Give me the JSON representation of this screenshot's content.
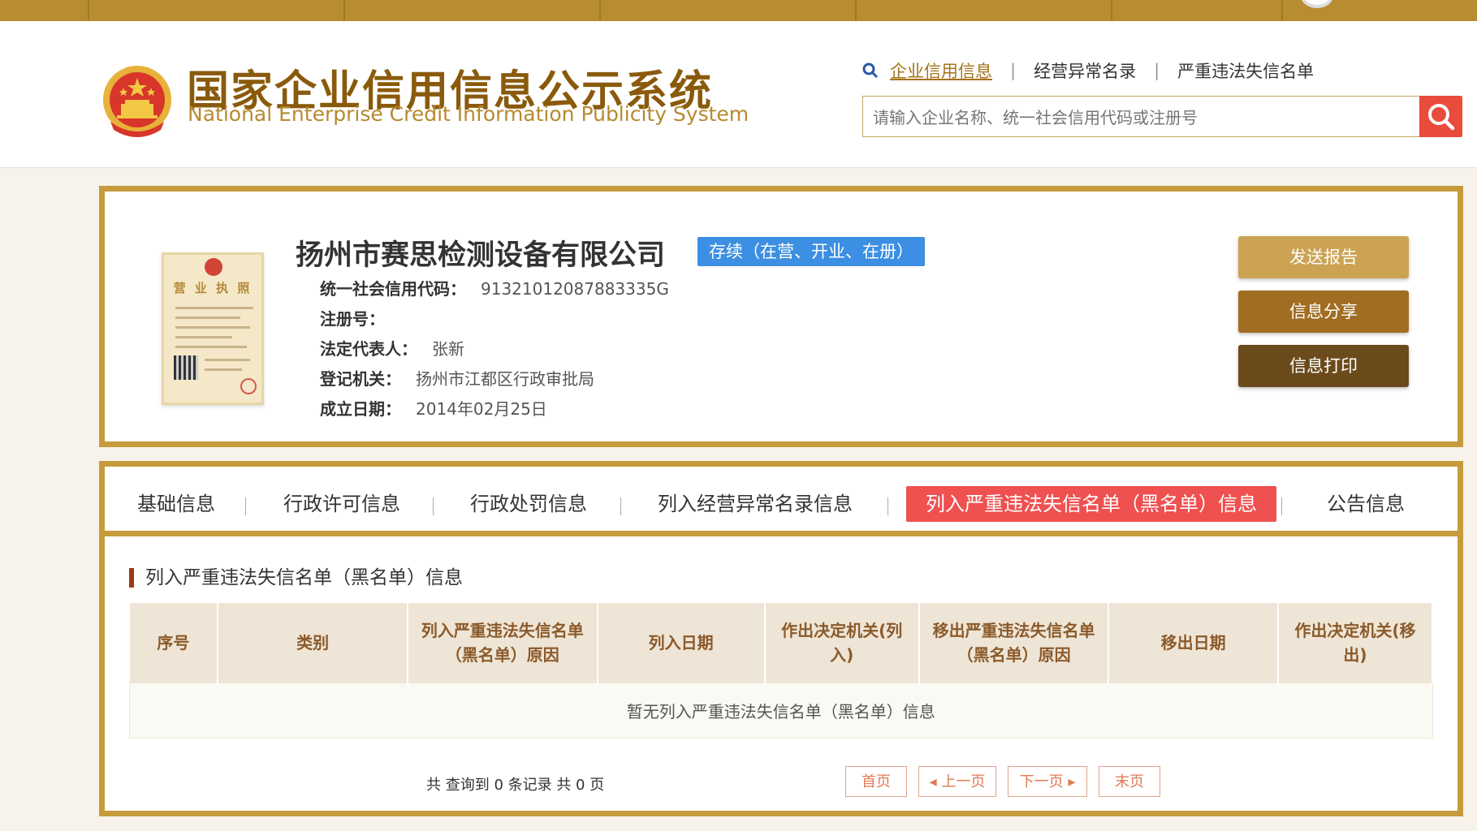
{
  "site": {
    "title": "国家企业信用信息公示系统",
    "subtitle": "National Enterprise Credit Information Publicity System"
  },
  "search": {
    "links": [
      "企业信用信息",
      "经营异常名录",
      "严重违法失信名单"
    ],
    "placeholder": "请输入企业名称、统一社会信用代码或注册号"
  },
  "company": {
    "name": "扬州市赛思检测设备有限公司",
    "status": "存续（在营、开业、在册）",
    "license_title": "营 业 执 照",
    "fields": [
      {
        "label": "统一社会信用代码：",
        "value": "91321012087883335G"
      },
      {
        "label": "注册号：",
        "value": ""
      },
      {
        "label": "法定代表人：",
        "value": "张新"
      },
      {
        "label": "登记机关：",
        "value": "扬州市江都区行政审批局"
      },
      {
        "label": "成立日期：",
        "value": "2014年02月25日"
      }
    ]
  },
  "actions": {
    "send": "发送报告",
    "share": "信息分享",
    "print": "信息打印"
  },
  "tabs": [
    "基础信息",
    "行政许可信息",
    "行政处罚信息",
    "列入经营异常名录信息",
    "列入严重违法失信名单（黑名单）信息",
    "公告信息"
  ],
  "section": {
    "title": "列入严重违法失信名单（黑名单）信息",
    "columns": [
      "序号",
      "类别",
      "列入严重违法失信名单（黑名单）原因",
      "列入日期",
      "作出决定机关(列入)",
      "移出严重违法失信名单（黑名单）原因",
      "移出日期",
      "作出决定机关(移出)"
    ],
    "empty_text": "暂无列入严重违法失信名单（黑名单）信息"
  },
  "pager": {
    "info": "共 查询到 0 条记录 共 0 页",
    "first": "首页",
    "prev": "上一页",
    "next": "下一页",
    "last": "末页"
  },
  "colors": {
    "gold_border": "#c69b3c",
    "active_tab": "#ef5050",
    "status_badge": "#3c8fe2"
  }
}
